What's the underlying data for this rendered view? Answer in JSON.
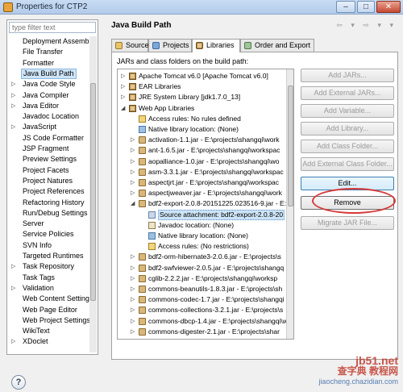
{
  "window": {
    "title": "Properties for CTP2",
    "controls": [
      "–",
      "□",
      "✕"
    ]
  },
  "left": {
    "filter_placeholder": "type filter text",
    "items": [
      {
        "label": "Deployment Assembly",
        "arrow": ""
      },
      {
        "label": "File Transfer",
        "arrow": ""
      },
      {
        "label": "Formatter",
        "arrow": ""
      },
      {
        "label": "Java Build Path",
        "arrow": "",
        "selected": true
      },
      {
        "label": "Java Code Style",
        "arrow": "▷"
      },
      {
        "label": "Java Compiler",
        "arrow": "▷"
      },
      {
        "label": "Java Editor",
        "arrow": "▷"
      },
      {
        "label": "Javadoc Location",
        "arrow": ""
      },
      {
        "label": "JavaScript",
        "arrow": "▷"
      },
      {
        "label": "JS Code Formatter",
        "arrow": ""
      },
      {
        "label": "JSP Fragment",
        "arrow": ""
      },
      {
        "label": "Preview Settings",
        "arrow": ""
      },
      {
        "label": "Project Facets",
        "arrow": ""
      },
      {
        "label": "Project Natures",
        "arrow": ""
      },
      {
        "label": "Project References",
        "arrow": ""
      },
      {
        "label": "Refactoring History",
        "arrow": ""
      },
      {
        "label": "Run/Debug Settings",
        "arrow": ""
      },
      {
        "label": "Server",
        "arrow": ""
      },
      {
        "label": "Service Policies",
        "arrow": ""
      },
      {
        "label": "SVN Info",
        "arrow": ""
      },
      {
        "label": "Targeted Runtimes",
        "arrow": ""
      },
      {
        "label": "Task Repository",
        "arrow": "▷"
      },
      {
        "label": "Task Tags",
        "arrow": ""
      },
      {
        "label": "Validation",
        "arrow": "▷"
      },
      {
        "label": "Web Content Settings",
        "arrow": ""
      },
      {
        "label": "Web Page Editor",
        "arrow": ""
      },
      {
        "label": "Web Project Settings",
        "arrow": ""
      },
      {
        "label": "WikiText",
        "arrow": ""
      },
      {
        "label": "XDoclet",
        "arrow": "▷"
      }
    ]
  },
  "main": {
    "title": "Java Build Path",
    "nav_arrows": "⇦ ▾ ⇨ ▾ ▾",
    "tabs": [
      {
        "label": "Source",
        "active": false
      },
      {
        "label": "Projects",
        "active": false
      },
      {
        "label": "Libraries",
        "active": true
      },
      {
        "label": "Order and Export",
        "active": false
      }
    ],
    "panel_label": "JARs and class folders on the build path:",
    "tree": [
      {
        "indent": 0,
        "arrow": "▷",
        "icon": "lib",
        "label": "Apache Tomcat v6.0 [Apache Tomcat v6.0]"
      },
      {
        "indent": 0,
        "arrow": "▷",
        "icon": "lib",
        "label": "EAR Libraries"
      },
      {
        "indent": 0,
        "arrow": "▷",
        "icon": "lib",
        "label": "JRE System Library [jdk1.7.0_13]"
      },
      {
        "indent": 0,
        "arrow": "◢",
        "icon": "lib",
        "label": "Web App Libraries"
      },
      {
        "indent": 1,
        "arrow": "",
        "icon": "access",
        "label": "Access rules: No rules defined"
      },
      {
        "indent": 1,
        "arrow": "",
        "icon": "native",
        "label": "Native library location: (None)"
      },
      {
        "indent": 1,
        "arrow": "▷",
        "icon": "jar",
        "label": "activation-1.1.jar - E:\\projects\\shangqi\\work"
      },
      {
        "indent": 1,
        "arrow": "▷",
        "icon": "jar",
        "label": "ant-1.6.5.jar - E:\\projects\\shangqi\\workspac"
      },
      {
        "indent": 1,
        "arrow": "▷",
        "icon": "jar",
        "label": "aopalliance-1.0.jar - E:\\projects\\shangqi\\wo"
      },
      {
        "indent": 1,
        "arrow": "▷",
        "icon": "jar",
        "label": "asm-3.3.1.jar - E:\\projects\\shangqi\\workspac"
      },
      {
        "indent": 1,
        "arrow": "▷",
        "icon": "jar",
        "label": "aspectjrt.jar - E:\\projects\\shangqi\\workspac"
      },
      {
        "indent": 1,
        "arrow": "▷",
        "icon": "jar",
        "label": "aspectjweaver.jar - E:\\projects\\shangqi\\work"
      },
      {
        "indent": 1,
        "arrow": "◢",
        "icon": "jar",
        "label": "bdf2-export-2.0.8-20151225.023516-9.jar - E:\\projects\\shangqi\\wo"
      },
      {
        "indent": 2,
        "arrow": "",
        "icon": "attach",
        "label": "Source attachment: bdf2-export-2.0.8-20",
        "selected": true
      },
      {
        "indent": 2,
        "arrow": "",
        "icon": "doc",
        "label": "Javadoc location: (None)"
      },
      {
        "indent": 2,
        "arrow": "",
        "icon": "native",
        "label": "Native library location: (None)"
      },
      {
        "indent": 2,
        "arrow": "",
        "icon": "access",
        "label": "Access rules: (No restrictions)"
      },
      {
        "indent": 1,
        "arrow": "▷",
        "icon": "jar",
        "label": "bdf2-orm-hibernate3-2.0.6.jar - E:\\projects\\s"
      },
      {
        "indent": 1,
        "arrow": "▷",
        "icon": "jar",
        "label": "bdf2-swfviewer-2.0.5.jar - E:\\projects\\shangq"
      },
      {
        "indent": 1,
        "arrow": "▷",
        "icon": "jar",
        "label": "cglib-2.2.2.jar - E:\\projects\\shangqi\\worksp"
      },
      {
        "indent": 1,
        "arrow": "▷",
        "icon": "jar",
        "label": "commons-beanutils-1.8.3.jar - E:\\projects\\sh"
      },
      {
        "indent": 1,
        "arrow": "▷",
        "icon": "jar",
        "label": "commons-codec-1.7.jar - E:\\projects\\shangqi"
      },
      {
        "indent": 1,
        "arrow": "▷",
        "icon": "jar",
        "label": "commons-collections-3.2.1.jar - E:\\projects\\s"
      },
      {
        "indent": 1,
        "arrow": "▷",
        "icon": "jar",
        "label": "commons-dbcp-1.4.jar - E:\\projects\\shangqi\\w"
      },
      {
        "indent": 1,
        "arrow": "▷",
        "icon": "jar",
        "label": "commons-digester-2.1.jar - E:\\projects\\shar"
      }
    ],
    "buttons": [
      {
        "label": "Add JARs...",
        "enabled": false
      },
      {
        "label": "Add External JARs...",
        "enabled": false
      },
      {
        "label": "Add Variable...",
        "enabled": false
      },
      {
        "label": "Add Library...",
        "enabled": false
      },
      {
        "label": "Add Class Folder...",
        "enabled": false
      },
      {
        "label": "Add External Class Folder...",
        "enabled": false
      },
      {
        "label": "Edit...",
        "enabled": true,
        "focus": true
      },
      {
        "label": "Remove",
        "enabled": true
      },
      {
        "label": "Migrate JAR File...",
        "enabled": false
      }
    ]
  },
  "help_label": "?",
  "watermark": {
    "site": "jb51.net",
    "line2": "查字典 教程网",
    "line3": "jiaocheng.chazidian.com"
  }
}
